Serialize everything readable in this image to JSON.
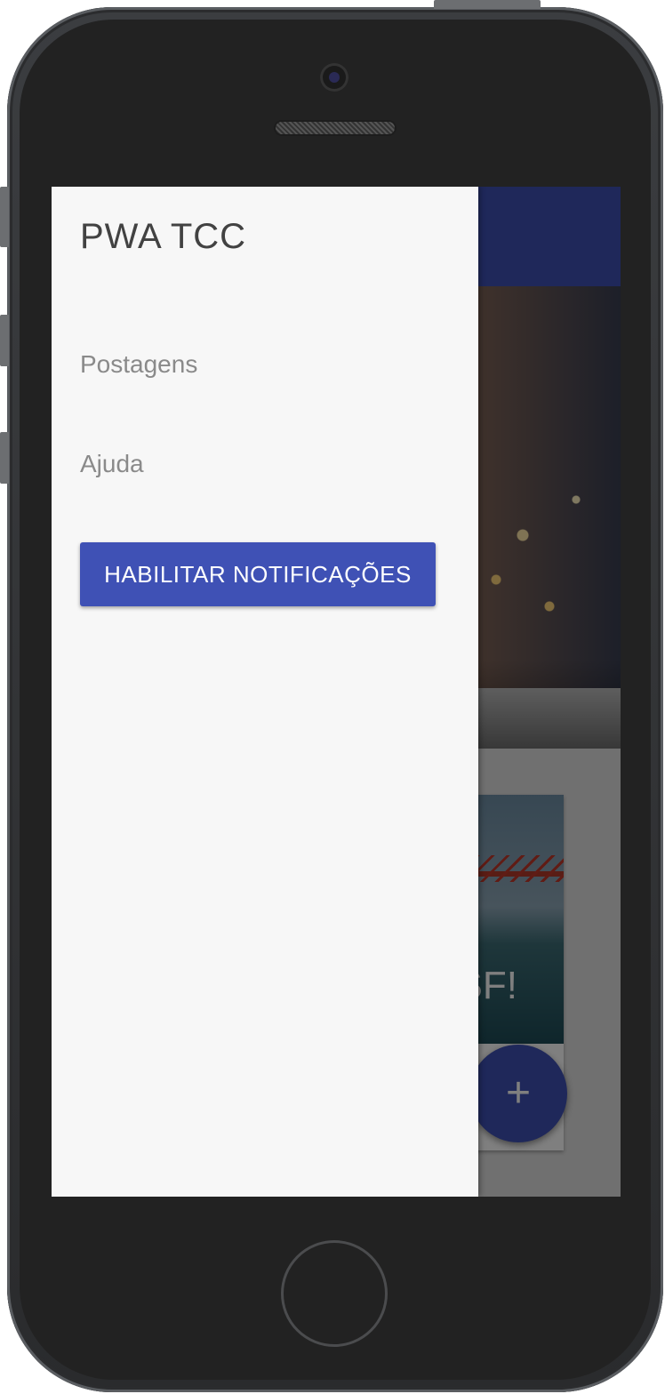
{
  "drawer": {
    "title": "PWA TCC",
    "links": [
      "Postagens",
      "Ajuda"
    ],
    "notify_button_label": "HABILITAR NOTIFICAÇÕES"
  },
  "background_page": {
    "card_title_fragment": "SF!",
    "fab_label": "+"
  },
  "colors": {
    "primary": "#3f51b5",
    "drawer_background": "#f7f7f7",
    "link_text": "#8a8a8a",
    "title_text": "#424242"
  },
  "icons": [
    "add-icon"
  ]
}
